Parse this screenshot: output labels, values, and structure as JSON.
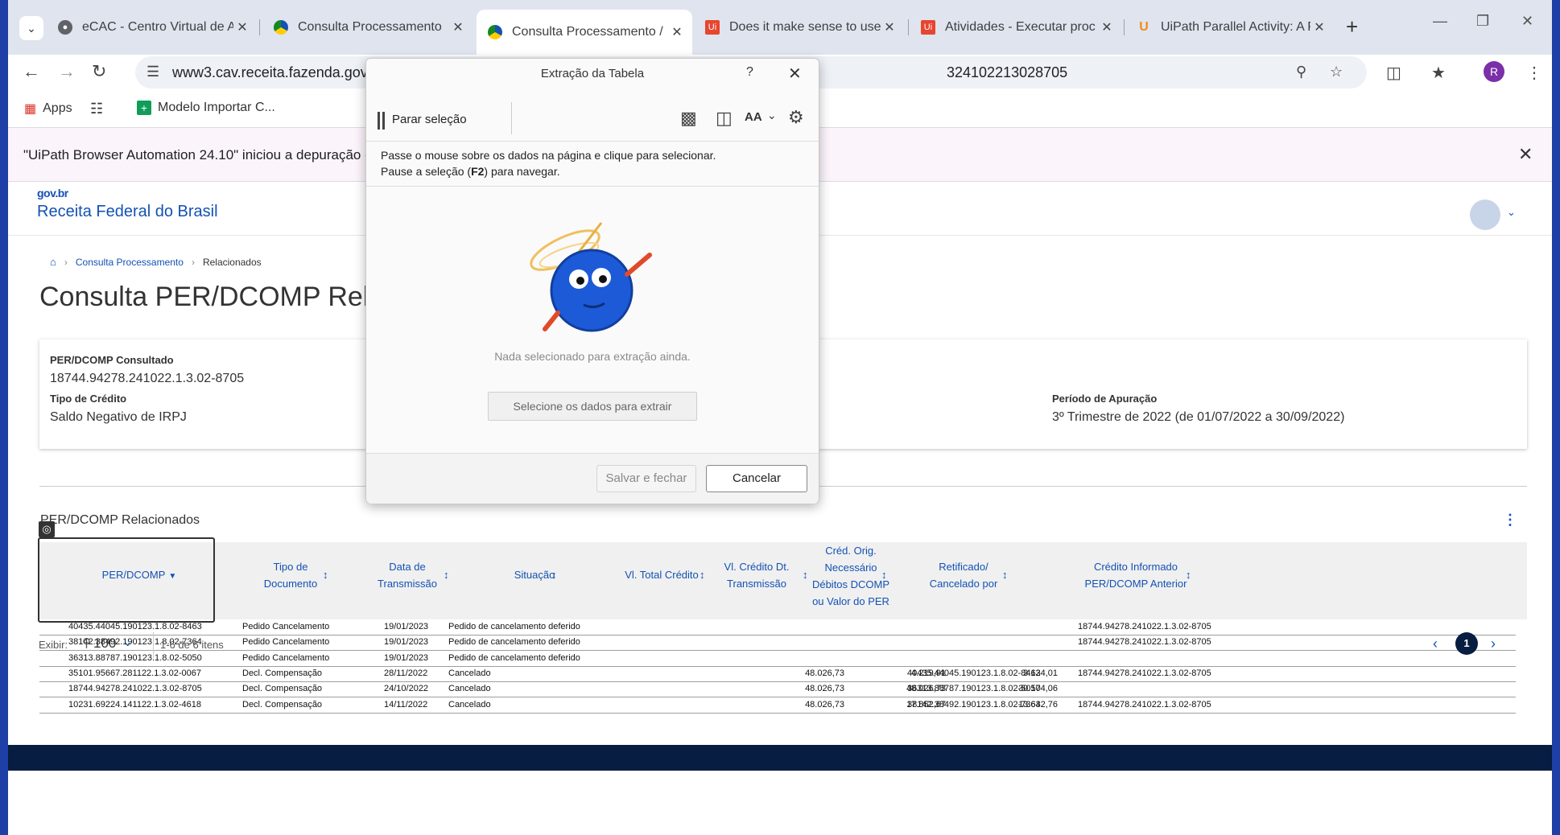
{
  "browser": {
    "tabs": [
      {
        "title": "eCAC - Centro Virtual de A",
        "icon": "globe-icon"
      },
      {
        "title": "Consulta Processamento",
        "icon": "govbr-icon"
      },
      {
        "title": "Consulta Processamento /",
        "icon": "govbr-icon",
        "active": true
      },
      {
        "title": "Does it make sense to use",
        "icon": "uipath-icon"
      },
      {
        "title": "Atividades - Executar proc",
        "icon": "uipath-icon"
      },
      {
        "title": "UiPath Parallel Activity: A P",
        "icon": "uipath-orange-icon"
      }
    ],
    "url_left": "www3.cav.receita.fazenda.gov.b",
    "url_right": "324102213028705",
    "profile_initial": "R",
    "bookmarks": {
      "apps": "Apps",
      "modelo": "Modelo Importar C..."
    }
  },
  "debug_bar": {
    "message": "\"UiPath Browser Automation 24.10\" iniciou a depuração de"
  },
  "site": {
    "brand_small": "gov.br",
    "brand": "Receita Federal do Brasil",
    "breadcrumbs": [
      "Consulta Processamento",
      "Relacionados"
    ],
    "page_title": "Consulta PER/DCOMP Rel"
  },
  "summary": {
    "consultado_label": "PER/DCOMP Consultado",
    "consultado_value": "18744.94278.241022.1.3.02-8705",
    "tipo_label": "Tipo de Crédito",
    "tipo_value": "Saldo Negativo de IRPJ",
    "periodo_label": "Período de Apuração",
    "periodo_value": "3º Trimestre de 2022 (de 01/07/2022 a 30/09/2022)"
  },
  "table": {
    "title": "PER/DCOMP Relacionados",
    "headers": {
      "perdcomp": "PER/DCOMP",
      "tipo": "Tipo de\nDocumento",
      "data": "Data de\nTransmissão",
      "situacao": "Situação",
      "vltotal": "Vl. Total Crédito",
      "vlcredito": "Vl. Crédito Dt.\nTransmissão",
      "cred": "Créd. Orig.\nNecessário\nDébitos DCOMP\nou Valor do PER",
      "retificado": "Retificado/\nCancelado por",
      "credinf": "Crédito Informado\nPER/DCOMP Anterior"
    },
    "rows": [
      {
        "perdcomp": "40435.44045.190123.1.8.02-8463",
        "tipo": "Pedido Cancelamento",
        "data": "19/01/2023",
        "situacao": "Pedido de cancelamento deferido",
        "vltotal": "",
        "vlcredito": "",
        "cred": "",
        "retificado": "",
        "credinf": "18744.94278.241022.1.3.02-8705"
      },
      {
        "perdcomp": "38142.38492.190123.1.8.02-7364",
        "tipo": "Pedido Cancelamento",
        "data": "19/01/2023",
        "situacao": "Pedido de cancelamento deferido",
        "vltotal": "",
        "vlcredito": "",
        "cred": "",
        "retificado": "",
        "credinf": "18744.94278.241022.1.3.02-8705"
      },
      {
        "perdcomp": "36313.88787.190123.1.8.02-5050",
        "tipo": "Pedido Cancelamento",
        "data": "19/01/2023",
        "situacao": "Pedido de cancelamento deferido",
        "vltotal": "",
        "vlcredito": "",
        "cred": "",
        "retificado": "",
        "credinf": ""
      },
      {
        "perdcomp": "35101.95667.281122.1.3.02-0067",
        "tipo": "Decl. Compensação",
        "data": "28/11/2022",
        "situacao": "Cancelado",
        "vltotal": "48.026,73",
        "vlcredito": "4.219,91",
        "cred": "3.124,01",
        "retificado": "40435.44045.190123.1.8.02-8463",
        "credinf": "18744.94278.241022.1.3.02-8705"
      },
      {
        "perdcomp": "18744.94278.241022.1.3.02-8705",
        "tipo": "Decl. Compensação",
        "data": "24/10/2022",
        "situacao": "Cancelado",
        "vltotal": "48.026,73",
        "vlcredito": "48.026,73",
        "cred": "30.174,06",
        "retificado": "36313.88787.190123.1.8.02-5050",
        "credinf": ""
      },
      {
        "perdcomp": "10231.69224.141122.1.3.02-4618",
        "tipo": "Decl. Compensação",
        "data": "14/11/2022",
        "situacao": "Cancelado",
        "vltotal": "48.026,73",
        "vlcredito": "17.852,67",
        "cred": "13.632,76",
        "retificado": "38142.38492.190123.1.8.02-7364",
        "credinf": "18744.94278.241022.1.3.02-8705"
      }
    ],
    "pager": {
      "show_label": "Exibir:",
      "page_size": "100",
      "range": "1-6 de 6 itens",
      "current_page": "1"
    }
  },
  "dialog": {
    "title": "Extração da Tabela",
    "help": "?",
    "stop_label": "Parar seleção",
    "font_label": "AA",
    "instruction_line1": "Passe o mouse sobre os dados na página e clique para selecionar.",
    "instruction_pre": "Pause a seleção (",
    "instruction_key": "F2",
    "instruction_post": ") para navegar.",
    "empty_text": "Nada selecionado para extração ainda.",
    "select_button": "Selecione os dados para extrair",
    "save_button": "Salvar e fechar",
    "cancel_button": "Cancelar"
  }
}
